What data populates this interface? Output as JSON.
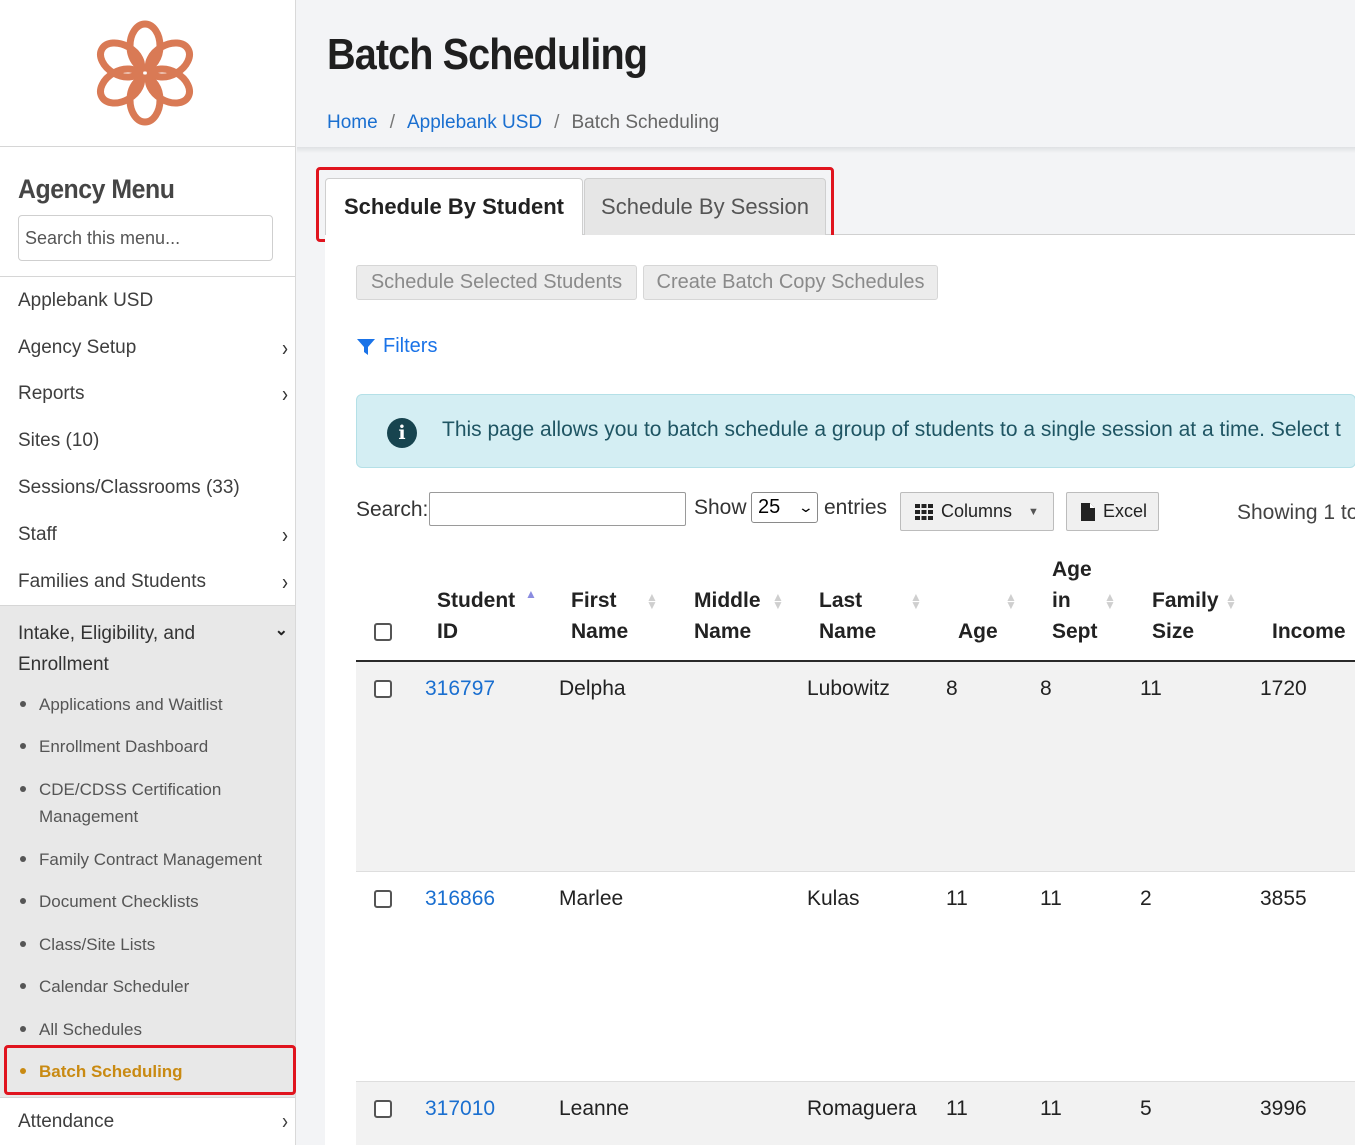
{
  "sidebar": {
    "menu_title": "Agency Menu",
    "search_placeholder": "Search this menu...",
    "items": [
      {
        "label": "Applebank USD",
        "chevron": false
      },
      {
        "label": "Agency Setup",
        "chevron": true
      },
      {
        "label": "Reports",
        "chevron": true
      },
      {
        "label": "Sites (10)",
        "chevron": false
      },
      {
        "label": "Sessions/Classrooms (33)",
        "chevron": false
      },
      {
        "label": "Staff",
        "chevron": true
      },
      {
        "label": "Families and Students",
        "chevron": true
      }
    ],
    "open_group": {
      "title": "Intake, Eligibility, and Enrollment",
      "children": [
        "Applications and Waitlist",
        "Enrollment Dashboard",
        "CDE/CDSS Certification Management",
        "Family Contract Management",
        "Document Checklists",
        "Class/Site Lists",
        "Calendar Scheduler",
        "All Schedules",
        "Batch Scheduling"
      ],
      "active": "Batch Scheduling"
    },
    "after_group": "Attendance"
  },
  "header": {
    "title": "Batch Scheduling",
    "breadcrumb": [
      "Home",
      "Applebank USD",
      "Batch Scheduling"
    ],
    "sep": "/"
  },
  "tabs": [
    "Schedule By Student",
    "Schedule By Session"
  ],
  "actions": {
    "schedule_selected": "Schedule Selected Students",
    "create_batch_copy": "Create Batch Copy Schedules",
    "filters": "Filters"
  },
  "info_text": "This page allows you to batch schedule a group of students to a single session at a time. Select t",
  "table_controls": {
    "search_label": "Search:",
    "show_label": "Show",
    "page_length": "25",
    "entries_label": "entries",
    "columns_label": "Columns",
    "excel_label": "Excel",
    "showing": "Showing 1 to"
  },
  "table": {
    "columns": [
      [
        "Student",
        "ID"
      ],
      [
        "First",
        "Name"
      ],
      [
        "Middle",
        "Name"
      ],
      [
        "Last",
        "Name"
      ],
      [
        "Age"
      ],
      [
        "Age",
        "in",
        "Sept"
      ],
      [
        "Family",
        "Size"
      ],
      [
        "Income"
      ]
    ],
    "rows": [
      {
        "id": "316797",
        "first": "Delpha",
        "middle": "",
        "last": "Lubowitz",
        "age": "8",
        "age_sept": "8",
        "family_size": "11",
        "income": "1720"
      },
      {
        "id": "316866",
        "first": "Marlee",
        "middle": "",
        "last": "Kulas",
        "age": "11",
        "age_sept": "11",
        "family_size": "2",
        "income": "3855"
      },
      {
        "id": "317010",
        "first": "Leanne",
        "middle": "",
        "last": "Romaguera",
        "age": "11",
        "age_sept": "11",
        "family_size": "5",
        "income": "3996"
      }
    ]
  },
  "colors": {
    "accent_link": "#1a6fd0",
    "active_menu": "#c98a12",
    "highlight_box": "#e0141e",
    "logo": "#d97a55",
    "info_bg": "#d4eef3"
  }
}
